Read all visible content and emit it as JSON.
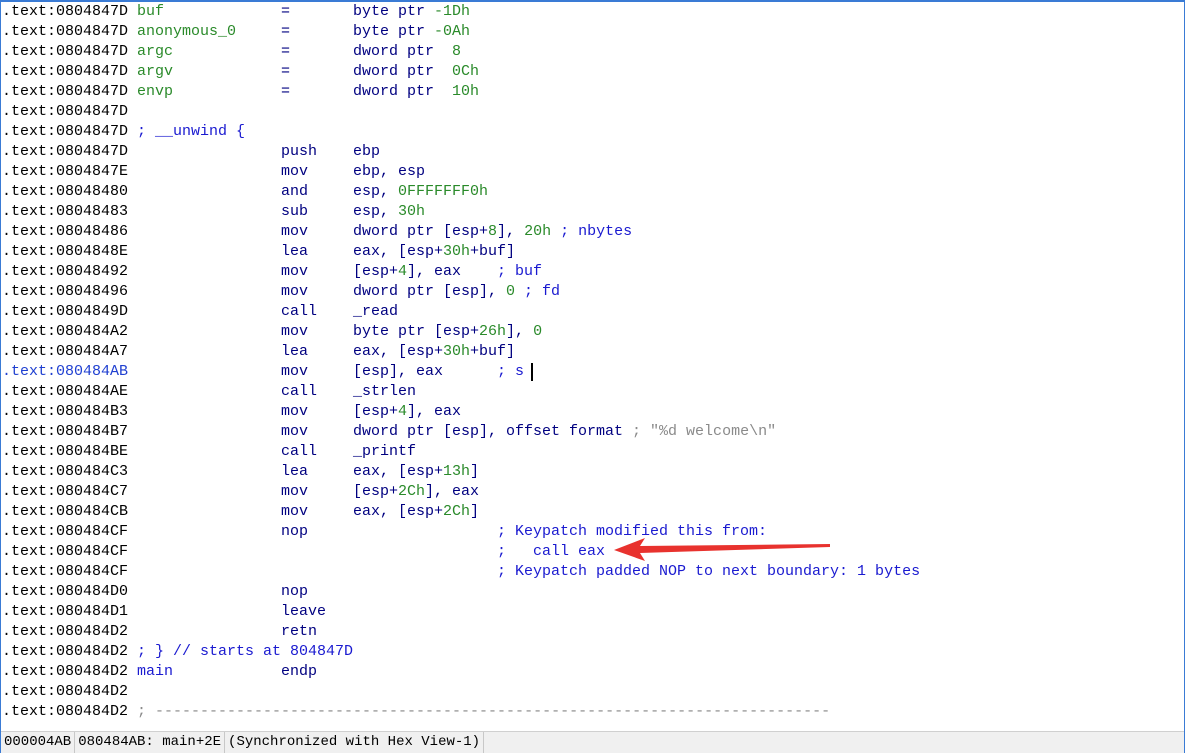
{
  "colors": {
    "label": "#2a8a2a",
    "mnemonic": "#000080",
    "number": "#2a8a2a",
    "comment": "#1a1ad0",
    "gray": "#8a8a8a",
    "arrow": "#e8322e"
  },
  "selected_index": 18,
  "lines": [
    {
      "a": ".text:0804847D",
      "l": "buf",
      "lc": "label",
      "m": "=",
      "ops": [
        [
          "byte ptr ",
          "o"
        ],
        [
          "-1Dh",
          "n"
        ]
      ]
    },
    {
      "a": ".text:0804847D",
      "l": "anonymous_0",
      "lc": "label",
      "m": "=",
      "ops": [
        [
          "byte ptr ",
          "o"
        ],
        [
          "-0Ah",
          "n"
        ]
      ]
    },
    {
      "a": ".text:0804847D",
      "l": "argc",
      "lc": "label",
      "m": "=",
      "ops": [
        [
          "dword ptr  ",
          "o"
        ],
        [
          "8",
          "n"
        ]
      ]
    },
    {
      "a": ".text:0804847D",
      "l": "argv",
      "lc": "label",
      "m": "=",
      "ops": [
        [
          "dword ptr  ",
          "o"
        ],
        [
          "0Ch",
          "n"
        ]
      ]
    },
    {
      "a": ".text:0804847D",
      "l": "envp",
      "lc": "label",
      "m": "=",
      "ops": [
        [
          "dword ptr  ",
          "o"
        ],
        [
          "10h",
          "n"
        ]
      ]
    },
    {
      "a": ".text:0804847D"
    },
    {
      "a": ".text:0804847D",
      "l": "; __unwind {",
      "lc": "c"
    },
    {
      "a": ".text:0804847D",
      "m": "push",
      "ops": [
        [
          "ebp",
          "o"
        ]
      ]
    },
    {
      "a": ".text:0804847E",
      "m": "mov",
      "ops": [
        [
          "ebp, esp",
          "o"
        ]
      ]
    },
    {
      "a": ".text:08048480",
      "m": "and",
      "ops": [
        [
          "esp, ",
          "o"
        ],
        [
          "0FFFFFFF0h",
          "n"
        ]
      ]
    },
    {
      "a": ".text:08048483",
      "m": "sub",
      "ops": [
        [
          "esp, ",
          "o"
        ],
        [
          "30h",
          "n"
        ]
      ]
    },
    {
      "a": ".text:08048486",
      "m": "mov",
      "ops": [
        [
          "dword ptr [esp+",
          "o"
        ],
        [
          "8",
          "n"
        ],
        [
          "], ",
          "o"
        ],
        [
          "20h",
          "n"
        ],
        [
          " ; nbytes",
          "c"
        ]
      ]
    },
    {
      "a": ".text:0804848E",
      "m": "lea",
      "ops": [
        [
          "eax, [esp+",
          "o"
        ],
        [
          "30h",
          "n"
        ],
        [
          "+buf]",
          "o"
        ]
      ]
    },
    {
      "a": ".text:08048492",
      "m": "mov",
      "ops": [
        [
          "[esp+",
          "o"
        ],
        [
          "4",
          "n"
        ],
        [
          "], eax",
          "o"
        ]
      ],
      "cmt": "; buf"
    },
    {
      "a": ".text:08048496",
      "m": "mov",
      "ops": [
        [
          "dword ptr [esp], ",
          "o"
        ],
        [
          "0",
          "n"
        ],
        [
          " ; fd",
          "c"
        ]
      ]
    },
    {
      "a": ".text:0804849D",
      "m": "call",
      "ops": [
        [
          "_read",
          "o"
        ]
      ]
    },
    {
      "a": ".text:080484A2",
      "m": "mov",
      "ops": [
        [
          "byte ptr [esp+",
          "o"
        ],
        [
          "26h",
          "n"
        ],
        [
          "], ",
          "o"
        ],
        [
          "0",
          "n"
        ]
      ]
    },
    {
      "a": ".text:080484A7",
      "m": "lea",
      "ops": [
        [
          "eax, [esp+",
          "o"
        ],
        [
          "30h",
          "n"
        ],
        [
          "+buf]",
          "o"
        ]
      ]
    },
    {
      "a": ".text:080484AB",
      "m": "mov",
      "ops": [
        [
          "[esp], eax",
          "o"
        ]
      ],
      "cmt": "; s"
    },
    {
      "a": ".text:080484AE",
      "m": "call",
      "ops": [
        [
          "_strlen",
          "o"
        ]
      ]
    },
    {
      "a": ".text:080484B3",
      "m": "mov",
      "ops": [
        [
          "[esp+",
          "o"
        ],
        [
          "4",
          "n"
        ],
        [
          "], eax",
          "o"
        ]
      ]
    },
    {
      "a": ".text:080484B7",
      "m": "mov",
      "ops": [
        [
          "dword ptr [esp], offset format",
          "o"
        ],
        [
          " ; \"%d welcome\\n\"",
          "g"
        ]
      ]
    },
    {
      "a": ".text:080484BE",
      "m": "call",
      "ops": [
        [
          "_printf",
          "o"
        ]
      ]
    },
    {
      "a": ".text:080484C3",
      "m": "lea",
      "ops": [
        [
          "eax, [esp+",
          "o"
        ],
        [
          "13h",
          "n"
        ],
        [
          "]",
          "o"
        ]
      ]
    },
    {
      "a": ".text:080484C7",
      "m": "mov",
      "ops": [
        [
          "[esp+",
          "o"
        ],
        [
          "2Ch",
          "n"
        ],
        [
          "], eax",
          "o"
        ]
      ]
    },
    {
      "a": ".text:080484CB",
      "m": "mov",
      "ops": [
        [
          "eax, [esp+",
          "o"
        ],
        [
          "2Ch",
          "n"
        ],
        [
          "]",
          "o"
        ]
      ]
    },
    {
      "a": ".text:080484CF",
      "m": "nop",
      "cmt": "; Keypatch modified this from:"
    },
    {
      "a": ".text:080484CF",
      "cmt": ";   call eax"
    },
    {
      "a": ".text:080484CF",
      "cmt": "; Keypatch padded NOP to next boundary: 1 bytes"
    },
    {
      "a": ".text:080484D0",
      "m": "nop"
    },
    {
      "a": ".text:080484D1",
      "m": "leave"
    },
    {
      "a": ".text:080484D2",
      "m": "retn"
    },
    {
      "a": ".text:080484D2",
      "l": "; } // starts at 804847D",
      "lc": "c"
    },
    {
      "a": ".text:080484D2",
      "l": "main",
      "lc": "name",
      "m": "endp"
    },
    {
      "a": ".text:080484D2"
    },
    {
      "a": ".text:080484D2",
      "l": "; ---------------------------------------------------------------------------",
      "lc": "g"
    }
  ],
  "status": {
    "offset": "000004AB",
    "location": "080484AB: main+2E",
    "sync": "(Synchronized with Hex View-1)"
  }
}
